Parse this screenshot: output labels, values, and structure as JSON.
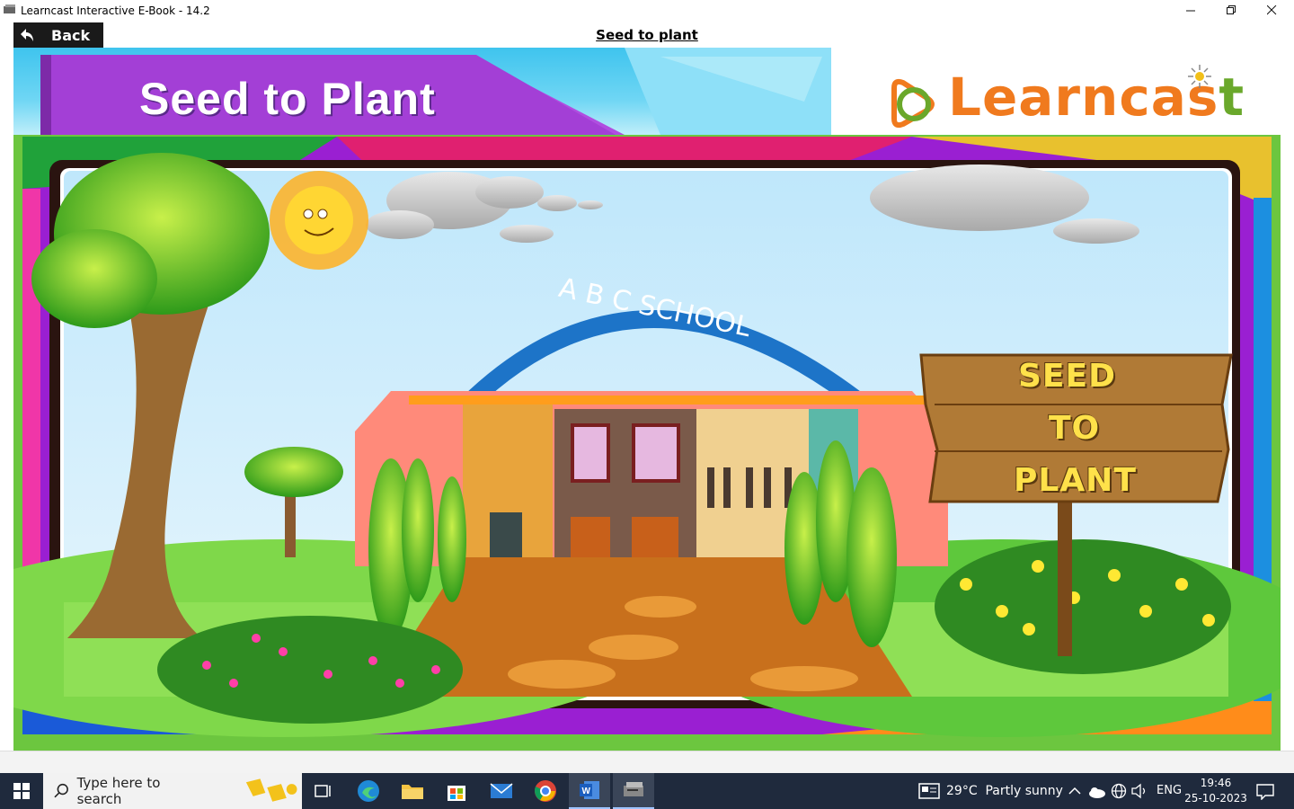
{
  "window": {
    "title": "Learncast Interactive E-Book - 14.2"
  },
  "nav": {
    "back_label": "Back",
    "page_heading": "Seed to plant"
  },
  "banner": {
    "title": "Seed to Plant"
  },
  "brand": {
    "logo_main": "Learncas",
    "logo_tail": "t",
    "color_orange": "#f07a1e",
    "color_green": "#6aa82b"
  },
  "scene": {
    "arch_text": "A B C SCHOOL",
    "sign_lines": [
      "SEED",
      "TO",
      "PLANT"
    ]
  },
  "taskbar": {
    "search_placeholder": "Type here to search",
    "weather": "29°C  Partly sunny",
    "language": "ENG",
    "time": "19:46",
    "date": "25-10-2023"
  }
}
